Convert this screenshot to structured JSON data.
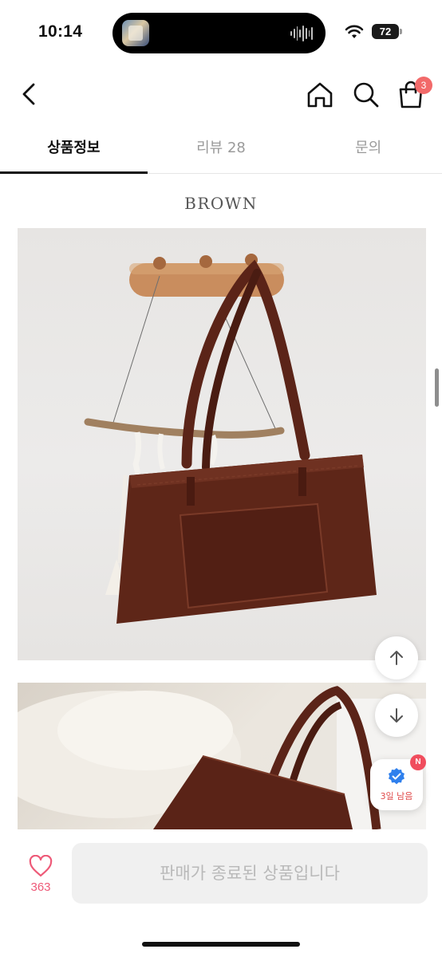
{
  "status_bar": {
    "time": "10:14",
    "battery": "72"
  },
  "header": {
    "back_icon": "chevron-left-icon",
    "home_icon": "home-icon",
    "search_icon": "search-icon",
    "cart_icon": "shopping-bag-icon",
    "cart_badge": "3"
  },
  "tabs": [
    {
      "label": "상품정보",
      "active": true
    },
    {
      "label": "리뷰 28",
      "active": false
    },
    {
      "label": "문의",
      "active": false
    }
  ],
  "content": {
    "color_label": "BROWN"
  },
  "floating": {
    "scroll_up_icon": "arrow-up-icon",
    "scroll_down_icon": "arrow-down-icon",
    "coupon_icon": "verified-badge-icon",
    "coupon_text": "3일 남음",
    "new_badge": "N"
  },
  "bottom_bar": {
    "like_icon": "heart-icon",
    "like_count": "363",
    "sold_out_label": "판매가 종료된 상품입니다"
  },
  "colors": {
    "accent_red": "#f26a6a",
    "like_pink": "#ee5a78",
    "coupon_blue": "#2f80ed",
    "bag_brown": "#5b2418"
  }
}
